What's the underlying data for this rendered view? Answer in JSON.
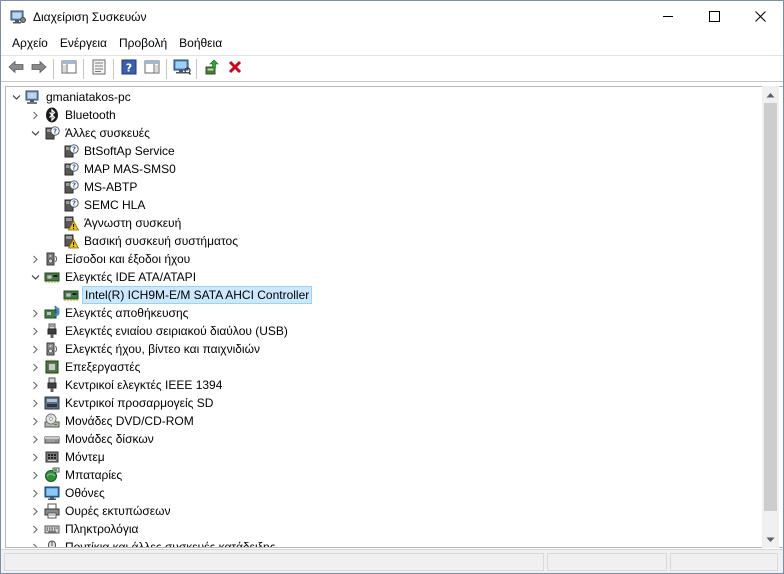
{
  "window": {
    "title": "Διαχείριση Συσκευών",
    "icon": "device-manager-icon"
  },
  "menu": [
    {
      "label": "Αρχείο"
    },
    {
      "label": "Ενέργεια"
    },
    {
      "label": "Προβολή"
    },
    {
      "label": "Βοήθεια"
    }
  ],
  "toolbar": {
    "icons": [
      "back-arrow-icon",
      "forward-arrow-icon",
      "properties-panel-icon",
      "properties-sheet-icon",
      "help-icon",
      "action-pane-icon",
      "monitor-scan-icon",
      "update-driver-icon",
      "uninstall-device-icon"
    ]
  },
  "tree": {
    "root": {
      "label": "gmaniatakos-pc",
      "icon": "computer-icon"
    },
    "items": [
      {
        "label": "Bluetooth",
        "icon": "bluetooth-icon",
        "level": 1,
        "expander": "collapsed"
      },
      {
        "label": "Άλλες συσκευές",
        "icon": "unknown-device-icon",
        "level": 1,
        "expander": "expanded"
      },
      {
        "label": "BtSoftAp Service",
        "icon": "unknown-device-icon",
        "level": 2,
        "expander": "none"
      },
      {
        "label": "MAP MAS-SMS0",
        "icon": "unknown-device-icon",
        "level": 2,
        "expander": "none"
      },
      {
        "label": "MS-ABTP",
        "icon": "unknown-device-icon",
        "level": 2,
        "expander": "none"
      },
      {
        "label": "SEMC HLA",
        "icon": "unknown-device-icon",
        "level": 2,
        "expander": "none"
      },
      {
        "label": "Άγνωστη συσκευή",
        "icon": "warning-device-icon",
        "level": 2,
        "expander": "none"
      },
      {
        "label": "Βασική συσκευή συστήματος",
        "icon": "warning-device-icon",
        "level": 2,
        "expander": "none"
      },
      {
        "label": "Είσοδοι και έξοδοι ήχου",
        "icon": "speaker-icon",
        "level": 1,
        "expander": "collapsed"
      },
      {
        "label": "Ελεγκτές IDE ATA/ATAPI",
        "icon": "ide-controller-icon",
        "level": 1,
        "expander": "expanded"
      },
      {
        "label": "Intel(R) ICH9M-E/M SATA AHCI Controller",
        "icon": "ide-controller-icon",
        "level": 2,
        "expander": "none",
        "selected": true
      },
      {
        "label": "Ελεγκτές αποθήκευσης",
        "icon": "storage-controller-icon",
        "level": 1,
        "expander": "collapsed"
      },
      {
        "label": "Ελεγκτές ενιαίου σειριακού διαύλου (USB)",
        "icon": "usb-icon",
        "level": 1,
        "expander": "collapsed"
      },
      {
        "label": "Ελεγκτές ήχου, βίντεο και παιχνιδιών",
        "icon": "sound-video-icon",
        "level": 1,
        "expander": "collapsed"
      },
      {
        "label": "Επεξεργαστές",
        "icon": "processor-icon",
        "level": 1,
        "expander": "collapsed"
      },
      {
        "label": "Κεντρικοί ελεγκτές IEEE 1394",
        "icon": "ieee1394-icon",
        "level": 1,
        "expander": "collapsed"
      },
      {
        "label": "Κεντρικοί προσαρμογείς SD",
        "icon": "sd-host-icon",
        "level": 1,
        "expander": "collapsed"
      },
      {
        "label": "Μονάδες DVD/CD-ROM",
        "icon": "dvd-drive-icon",
        "level": 1,
        "expander": "collapsed"
      },
      {
        "label": "Μονάδες δίσκων",
        "icon": "disk-drive-icon",
        "level": 1,
        "expander": "collapsed"
      },
      {
        "label": "Μόντεμ",
        "icon": "modem-icon",
        "level": 1,
        "expander": "collapsed"
      },
      {
        "label": "Μπαταρίες",
        "icon": "battery-icon",
        "level": 1,
        "expander": "collapsed"
      },
      {
        "label": "Οθόνες",
        "icon": "monitor-icon",
        "level": 1,
        "expander": "collapsed"
      },
      {
        "label": "Ουρές εκτυπώσεων",
        "icon": "printer-icon",
        "level": 1,
        "expander": "collapsed"
      },
      {
        "label": "Πληκτρολόγια",
        "icon": "keyboard-icon",
        "level": 1,
        "expander": "collapsed"
      },
      {
        "label": "Ποντίκια και άλλες συσκευές κατάδειξης",
        "icon": "mouse-icon",
        "level": 1,
        "expander": "collapsed"
      }
    ]
  },
  "colors": {
    "selection_bg": "#cce8ff",
    "selection_border": "#99d1ff",
    "delete_red": "#d0021b"
  }
}
